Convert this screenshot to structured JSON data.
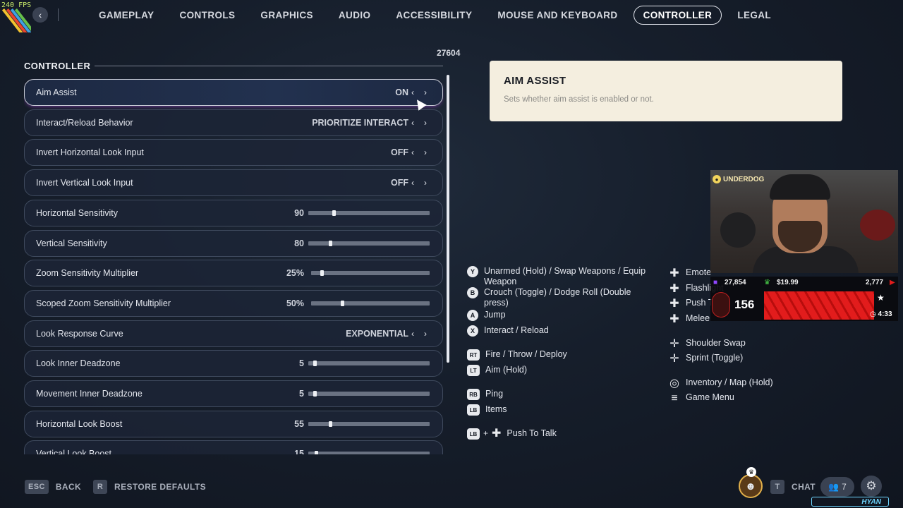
{
  "overlay": {
    "fps": "240 FPS",
    "counter": "27604"
  },
  "nav": {
    "tabs": [
      {
        "label": "GAMEPLAY",
        "active": false
      },
      {
        "label": "CONTROLS",
        "active": false
      },
      {
        "label": "GRAPHICS",
        "active": false
      },
      {
        "label": "AUDIO",
        "active": false
      },
      {
        "label": "ACCESSIBILITY",
        "active": false
      },
      {
        "label": "MOUSE AND KEYBOARD",
        "active": false
      },
      {
        "label": "CONTROLLER",
        "active": true
      },
      {
        "label": "LEGAL",
        "active": false
      }
    ]
  },
  "section": {
    "title": "CONTROLLER"
  },
  "settings": [
    {
      "label": "Aim Assist",
      "type": "choice",
      "value": "ON",
      "active": true
    },
    {
      "label": "Interact/Reload Behavior",
      "type": "choice",
      "value": "PRIORITIZE INTERACT"
    },
    {
      "label": "Invert Horizontal Look Input",
      "type": "choice",
      "value": "OFF"
    },
    {
      "label": "Invert Vertical Look Input",
      "type": "choice",
      "value": "OFF"
    },
    {
      "label": "Horizontal Sensitivity",
      "type": "slider",
      "value": "90",
      "level": 0.2
    },
    {
      "label": "Vertical Sensitivity",
      "type": "slider",
      "value": "80",
      "level": 0.17
    },
    {
      "label": "Zoom Sensitivity Multiplier",
      "type": "slider",
      "value": "25%",
      "level": 0.08
    },
    {
      "label": "Scoped Zoom Sensitivity Multiplier",
      "type": "slider",
      "value": "50%",
      "level": 0.25
    },
    {
      "label": "Look Response Curve",
      "type": "choice",
      "value": "EXPONENTIAL"
    },
    {
      "label": "Look Inner Deadzone",
      "type": "slider",
      "value": "5",
      "level": 0.04
    },
    {
      "label": "Movement Inner Deadzone",
      "type": "slider",
      "value": "5",
      "level": 0.04
    },
    {
      "label": "Horizontal Look Boost",
      "type": "slider",
      "value": "55",
      "level": 0.17
    },
    {
      "label": "Vertical Look Boost",
      "type": "slider",
      "value": "15",
      "level": 0.05
    }
  ],
  "info": {
    "title": "AIM ASSIST",
    "description": "Sets whether aim assist is enabled or not."
  },
  "bindings_left": [
    {
      "button": "Y",
      "shape": "circle",
      "text": "Unarmed (Hold) / Swap Weapons / Equip Weapon"
    },
    {
      "button": "B",
      "shape": "circle",
      "text": "Crouch (Toggle) / Dodge Roll (Double press)"
    },
    {
      "button": "A",
      "shape": "circle",
      "text": "Jump"
    },
    {
      "button": "X",
      "shape": "circle",
      "text": "Interact / Reload"
    },
    {
      "button": "RT",
      "shape": "rect",
      "text": "Fire / Throw / Deploy"
    },
    {
      "button": "LT",
      "shape": "rect",
      "text": "Aim (Hold)"
    },
    {
      "button": "RB",
      "shape": "rect",
      "text": "Ping"
    },
    {
      "button": "LB",
      "shape": "rect",
      "text": "Items"
    },
    {
      "button": "LB",
      "shape": "rect",
      "text": "Push To Talk",
      "combo": "+"
    }
  ],
  "bindings_right": [
    {
      "icon": "dpad-up-icon",
      "text": "Emote"
    },
    {
      "icon": "dpad-left-icon",
      "text": "Flashlight"
    },
    {
      "icon": "dpad-right-icon",
      "text": "Push T"
    },
    {
      "icon": "dpad-down-icon",
      "text": "Melee"
    },
    {
      "icon": "left-stick-icon",
      "text": "Shoulder Swap"
    },
    {
      "icon": "left-stick-press-icon",
      "text": "Sprint (Toggle)"
    },
    {
      "icon": "view-button-icon",
      "text": "Inventory / Map (Hold)"
    },
    {
      "icon": "menu-button-icon",
      "text": "Game Menu"
    }
  ],
  "stream": {
    "team": "UNDERDOG",
    "viewers": "27,854",
    "money": "$19.99",
    "subs": "2,777",
    "count": "156",
    "timer": "4:33"
  },
  "footer": {
    "back_key": "ESC",
    "back_label": "BACK",
    "restore_key": "R",
    "restore_label": "RESTORE DEFAULTS",
    "chat_key": "T",
    "chat_label": "CHAT",
    "party_count": "7",
    "brand": "HYAN"
  },
  "colors": {
    "active_glow": "#a046dc",
    "info_bg": "#f4eedf",
    "accent_red": "#e21c1c"
  }
}
